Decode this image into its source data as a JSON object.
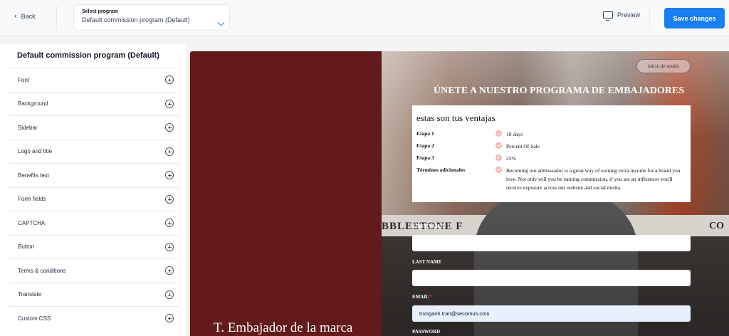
{
  "topbar": {
    "back_label": "Back",
    "select_label": "Select program",
    "select_value": "Default commission program (Default)",
    "preview_label": "Preview",
    "save_label": "Save changes"
  },
  "sidebar": {
    "title": "Default commission program (Default)",
    "items": [
      {
        "label": "Font"
      },
      {
        "label": "Background"
      },
      {
        "label": "Sidebar"
      },
      {
        "label": "Logo and title"
      },
      {
        "label": "Benefits text"
      },
      {
        "label": "Form fields"
      },
      {
        "label": "CAPTCHA"
      },
      {
        "label": "Button"
      },
      {
        "label": "Terms & conditions"
      },
      {
        "label": "Translate"
      },
      {
        "label": "Custom CSS"
      }
    ]
  },
  "preview": {
    "left_title": "T. Embajador de la marca",
    "login_label": "inicio de sesión",
    "join_title": "ÚNETE A NUESTRO PROGRAMA DE EMBAJADORES",
    "background_sign": "BBLESTONE F",
    "background_sign2": "CO",
    "benefits": {
      "title": "estas son tus ventajas",
      "rows": [
        {
          "label": "Etapa 1",
          "value": "10 days"
        },
        {
          "label": "Etapa 2",
          "value": "Percent Of Sale"
        },
        {
          "label": "Etapa 3",
          "value": "25%"
        },
        {
          "label": "Términos adicionales",
          "value": "Becoming our ambassador is a great way of earning extra income for a brand you love. Not only will you be earning commission, if you are an influencer you'll receive exposure across our website and social media."
        }
      ]
    },
    "form": {
      "first_name_label": "FIRST NAME",
      "last_name_label": "LAST NAME",
      "email_label": "EMAIL",
      "email_value": "trunganh.tran@secomus.com",
      "password_label": "PASSWORD",
      "required_mark": "*"
    }
  },
  "colors": {
    "accent": "#1a7ff0",
    "sidebar_panel": "#621a1a",
    "benefit_check": "#f4b6b6"
  }
}
